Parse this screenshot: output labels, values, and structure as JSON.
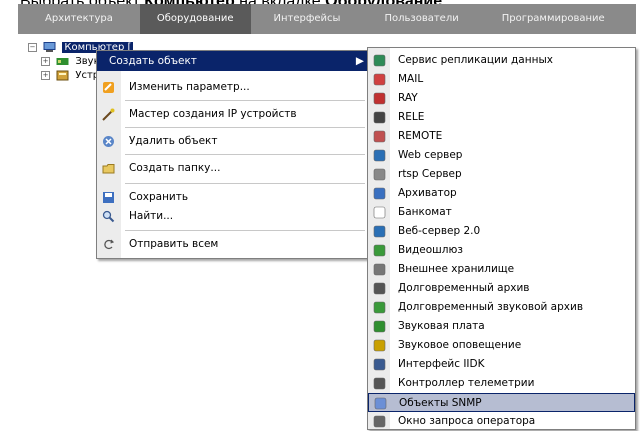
{
  "caption": {
    "prefix": "Выбрать объект",
    "bold1": "Компьютер",
    "middle": "на вкладке",
    "bold2": "Оборудование"
  },
  "tabs": [
    {
      "label": "Архитектура"
    },
    {
      "label": "Оборудование"
    },
    {
      "label": "Интерфейсы"
    },
    {
      "label": "Пользователи"
    },
    {
      "label": "Программирование"
    }
  ],
  "tree": {
    "root": "Компьютер [",
    "child1": "Звукова",
    "child2": "Устройст"
  },
  "context_menu": {
    "items": [
      {
        "label": "Создать объект",
        "icon": "create-object-icon"
      },
      {
        "label": "Изменить параметр...",
        "icon": "edit-parameter-icon"
      },
      {
        "label": "Мастер создания IP устройств",
        "icon": "wizard-icon"
      },
      {
        "label": "Удалить объект",
        "icon": "delete-icon"
      },
      {
        "label": "Создать папку...",
        "icon": "folder-icon"
      },
      {
        "label": "Сохранить",
        "icon": "save-icon"
      },
      {
        "label": "Найти...",
        "icon": "search-icon"
      },
      {
        "label": "Отправить всем",
        "icon": "send-icon"
      }
    ]
  },
  "submenu": {
    "items": [
      {
        "label": "Сервис репликации данных",
        "icon": "replication-icon",
        "color": "#2e8b57"
      },
      {
        "label": "MAIL",
        "icon": "mail-icon",
        "color": "#d04040"
      },
      {
        "label": "RAY",
        "icon": "ray-icon",
        "color": "#c03030"
      },
      {
        "label": "RELE",
        "icon": "rele-icon",
        "color": "#444444"
      },
      {
        "label": "REMOTE",
        "icon": "remote-icon",
        "color": "#c05050"
      },
      {
        "label": "Web сервер",
        "icon": "web-server-icon",
        "color": "#2a6fb5"
      },
      {
        "label": "rtsp Сервер",
        "icon": "rtsp-icon",
        "color": "#888888"
      },
      {
        "label": "Архиватор",
        "icon": "archiver-icon",
        "color": "#3a70c0"
      },
      {
        "label": "Банкомат",
        "icon": "atm-icon",
        "color": "#ffffff"
      },
      {
        "label": "Веб-сервер 2.0",
        "icon": "web-server-2-icon",
        "color": "#2a6fb5"
      },
      {
        "label": "Видеошлюз",
        "icon": "video-gateway-icon",
        "color": "#3a9a3a"
      },
      {
        "label": "Внешнее хранилище",
        "icon": "external-storage-icon",
        "color": "#777777"
      },
      {
        "label": "Долговременный архив",
        "icon": "long-term-archive-icon",
        "color": "#555555"
      },
      {
        "label": "Долговременный звуковой архив",
        "icon": "long-term-audio-archive-icon",
        "color": "#3a9a3a"
      },
      {
        "label": "Звуковая плата",
        "icon": "sound-card-icon",
        "color": "#2f8f2f"
      },
      {
        "label": "Звуковое оповещение",
        "icon": "sound-alert-icon",
        "color": "#c9a000"
      },
      {
        "label": "Интерфейс IIDK",
        "icon": "iidk-icon",
        "color": "#3a5a90"
      },
      {
        "label": "Контроллер телеметрии",
        "icon": "telemetry-icon",
        "color": "#555555"
      },
      {
        "label": "Объекты SNMP",
        "icon": "snmp-icon",
        "color": "#6b8fd6"
      },
      {
        "label": "Окно запроса оператора",
        "icon": "operator-request-icon",
        "color": "#666666"
      }
    ]
  }
}
